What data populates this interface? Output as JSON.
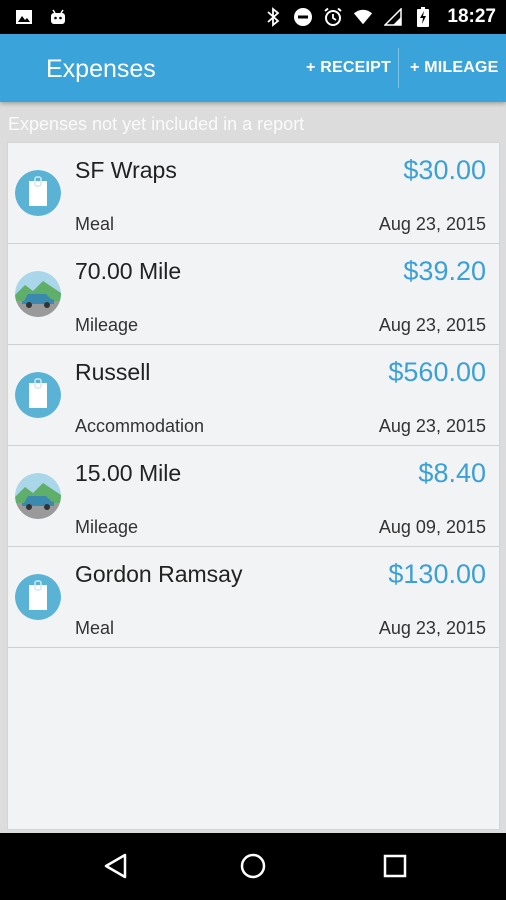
{
  "status_bar": {
    "time": "18:27",
    "left_icons": [
      "image-icon",
      "android-icon"
    ],
    "right_icons": [
      "bluetooth-icon",
      "do-not-disturb-icon",
      "alarm-icon",
      "wifi-icon",
      "signal-icon",
      "battery-charging-icon"
    ]
  },
  "app_bar": {
    "title": "Expenses",
    "receipt_label": "+ RECEIPT",
    "mileage_label": "+ MILEAGE",
    "color": "#3aa3d9"
  },
  "section_header": "Expenses not yet included in a report",
  "expenses": [
    {
      "name": "SF Wraps",
      "amount": "$30.00",
      "category": "Meal",
      "date": "Aug 23, 2015",
      "icon": "receipt-icon"
    },
    {
      "name": "70.00 Mile",
      "amount": "$39.20",
      "category": "Mileage",
      "date": "Aug 23, 2015",
      "icon": "car-icon"
    },
    {
      "name": "Russell",
      "amount": "$560.00",
      "category": "Accommodation",
      "date": "Aug 23, 2015",
      "icon": "receipt-icon"
    },
    {
      "name": "15.00 Mile",
      "amount": "$8.40",
      "category": "Mileage",
      "date": "Aug 09, 2015",
      "icon": "car-icon"
    },
    {
      "name": "Gordon Ramsay",
      "amount": "$130.00",
      "category": "Meal",
      "date": "Aug 23, 2015",
      "icon": "receipt-icon"
    }
  ],
  "colors": {
    "accent": "#3ba0d6",
    "card_bg": "#f2f3f5",
    "page_bg": "#dcdcdc"
  },
  "nav_bar": [
    "back-icon",
    "home-icon",
    "recents-icon"
  ]
}
